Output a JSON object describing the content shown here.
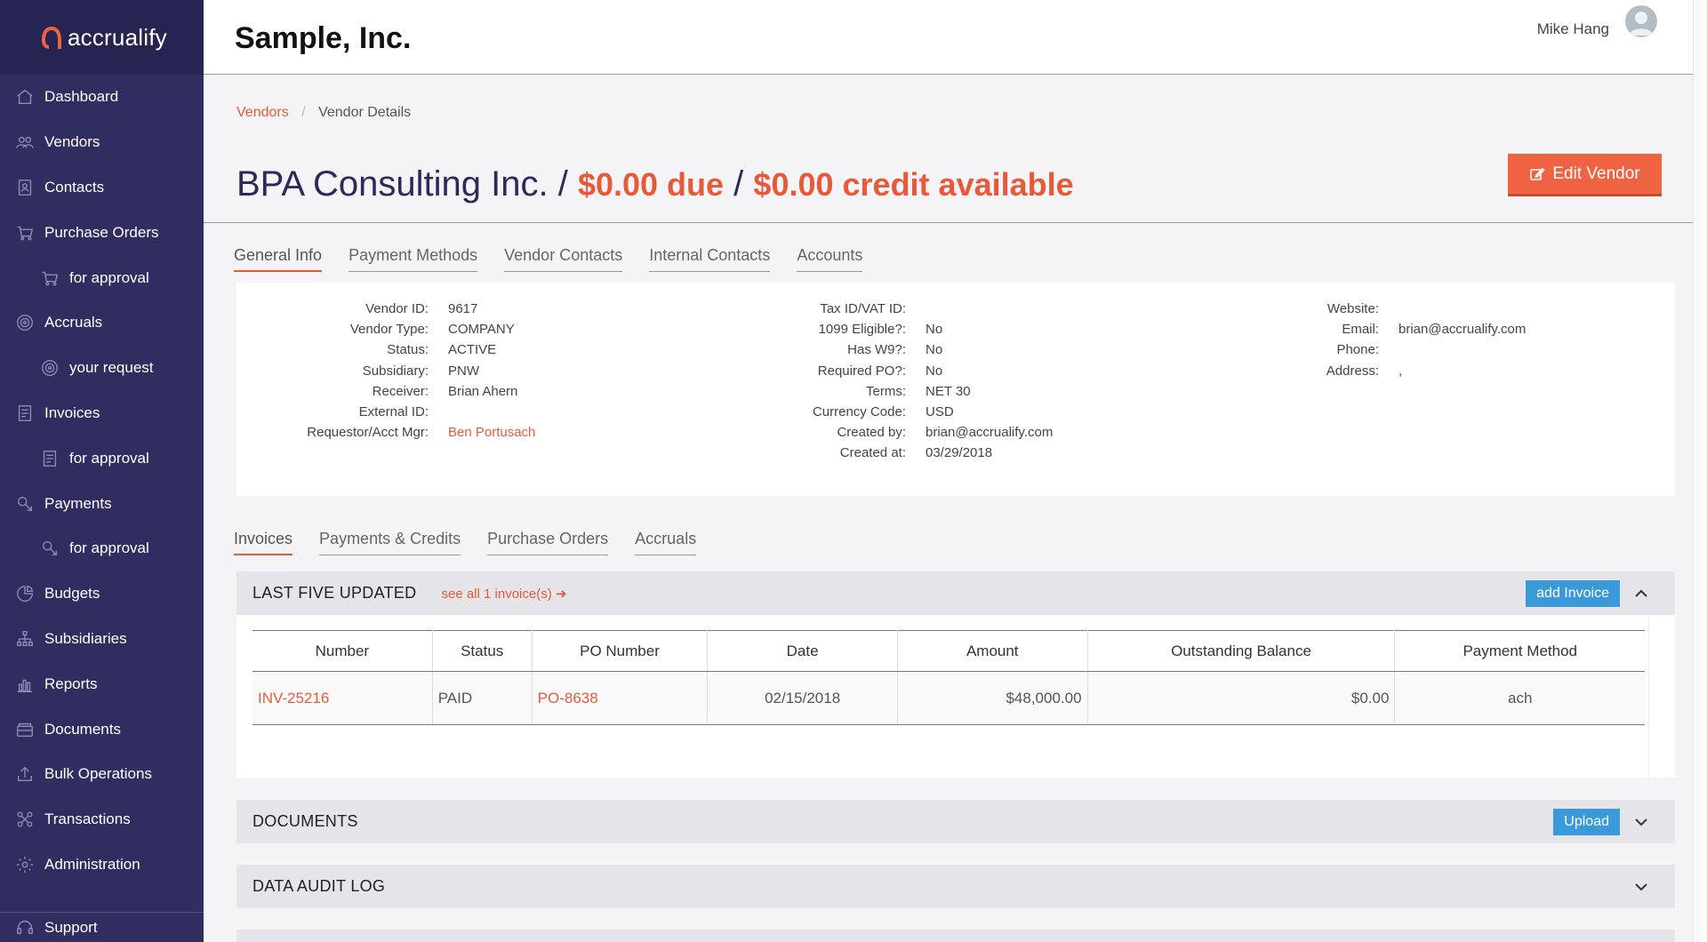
{
  "app": {
    "logo_text": "accrualify",
    "company": "Sample, Inc.",
    "user": "Mike Hang"
  },
  "sidebar": {
    "items": [
      {
        "label": "Dashboard",
        "icon": "home-icon",
        "sub": false
      },
      {
        "label": "Vendors",
        "icon": "users-icon",
        "sub": false
      },
      {
        "label": "Contacts",
        "icon": "contacts-icon",
        "sub": false
      },
      {
        "label": "Purchase Orders",
        "icon": "cart-icon",
        "sub": false
      },
      {
        "label": "for approval",
        "icon": "cart-icon",
        "sub": true
      },
      {
        "label": "Accruals",
        "icon": "target-icon",
        "sub": false
      },
      {
        "label": "your request",
        "icon": "target-icon",
        "sub": true
      },
      {
        "label": "Invoices",
        "icon": "invoice-icon",
        "sub": false
      },
      {
        "label": "for approval",
        "icon": "invoice-icon",
        "sub": true
      },
      {
        "label": "Payments",
        "icon": "payment-icon",
        "sub": false
      },
      {
        "label": "for approval",
        "icon": "payment-icon",
        "sub": true
      },
      {
        "label": "Budgets",
        "icon": "pie-icon",
        "sub": false
      },
      {
        "label": "Subsidiaries",
        "icon": "org-icon",
        "sub": false
      },
      {
        "label": "Reports",
        "icon": "bar-chart-icon",
        "sub": false
      },
      {
        "label": "Documents",
        "icon": "documents-icon",
        "sub": false
      },
      {
        "label": "Bulk Operations",
        "icon": "upload-icon",
        "sub": false
      },
      {
        "label": "Transactions",
        "icon": "transactions-icon",
        "sub": false
      },
      {
        "label": "Administration",
        "icon": "admin-icon",
        "sub": false
      }
    ],
    "support": "Support"
  },
  "breadcrumb": {
    "link": "Vendors",
    "current": "Vendor Details"
  },
  "vendor": {
    "name": "BPA Consulting Inc.",
    "slash": "/",
    "due": "$0.00 due",
    "credit": "$0.00 credit available",
    "edit_label": "Edit Vendor"
  },
  "tabs_top": [
    "General Info",
    "Payment Methods",
    "Vendor Contacts",
    "Internal Contacts",
    "Accounts"
  ],
  "info": {
    "col1": [
      {
        "label": "Vendor ID:",
        "value": "9617"
      },
      {
        "label": "Vendor Type:",
        "value": "COMPANY"
      },
      {
        "label": "Status:",
        "value": "ACTIVE"
      },
      {
        "label": "Subsidiary:",
        "value": "PNW"
      },
      {
        "label": "Receiver:",
        "value": "Brian Ahern"
      },
      {
        "label": "External ID:",
        "value": ""
      },
      {
        "label": "Requestor/Acct Mgr:",
        "value": "Ben Portusach",
        "link": true
      }
    ],
    "col2": [
      {
        "label": "Tax ID/VAT ID:",
        "value": ""
      },
      {
        "label": "1099 Eligible?:",
        "value": "No"
      },
      {
        "label": "Has W9?:",
        "value": "No"
      },
      {
        "label": "Required PO?:",
        "value": "No"
      },
      {
        "label": "Terms:",
        "value": "NET 30"
      },
      {
        "label": "Currency Code:",
        "value": "USD"
      },
      {
        "label": "Created by:",
        "value": "brian@accrualify.com"
      },
      {
        "label": "Created at:",
        "value": "03/29/2018"
      }
    ],
    "col3": [
      {
        "label": "Website:",
        "value": ""
      },
      {
        "label": "Email:",
        "value": "brian@accrualify.com"
      },
      {
        "label": "Phone:",
        "value": ""
      },
      {
        "label": "Address:",
        "value": ","
      }
    ]
  },
  "tabs_bottom": [
    "Invoices",
    "Payments & Credits",
    "Purchase Orders",
    "Accruals"
  ],
  "invoices": {
    "title": "LAST FIVE UPDATED",
    "see_all": "see all 1 invoice(s)",
    "add_label": "add Invoice",
    "columns": [
      "Number",
      "Status",
      "PO Number",
      "Date",
      "Amount",
      "Outstanding Balance",
      "Payment Method"
    ],
    "rows": [
      [
        "INV-25216",
        "PAID",
        "PO-8638",
        "02/15/2018",
        "$48,000.00",
        "$0.00",
        "ach"
      ]
    ]
  },
  "documents": {
    "title": "DOCUMENTS",
    "upload_label": "Upload"
  },
  "audit": {
    "title": "DATA AUDIT LOG"
  },
  "colors": {
    "accent": "#e8593a",
    "sidebar": "#302e61",
    "button_blue": "#3a9ad9"
  }
}
